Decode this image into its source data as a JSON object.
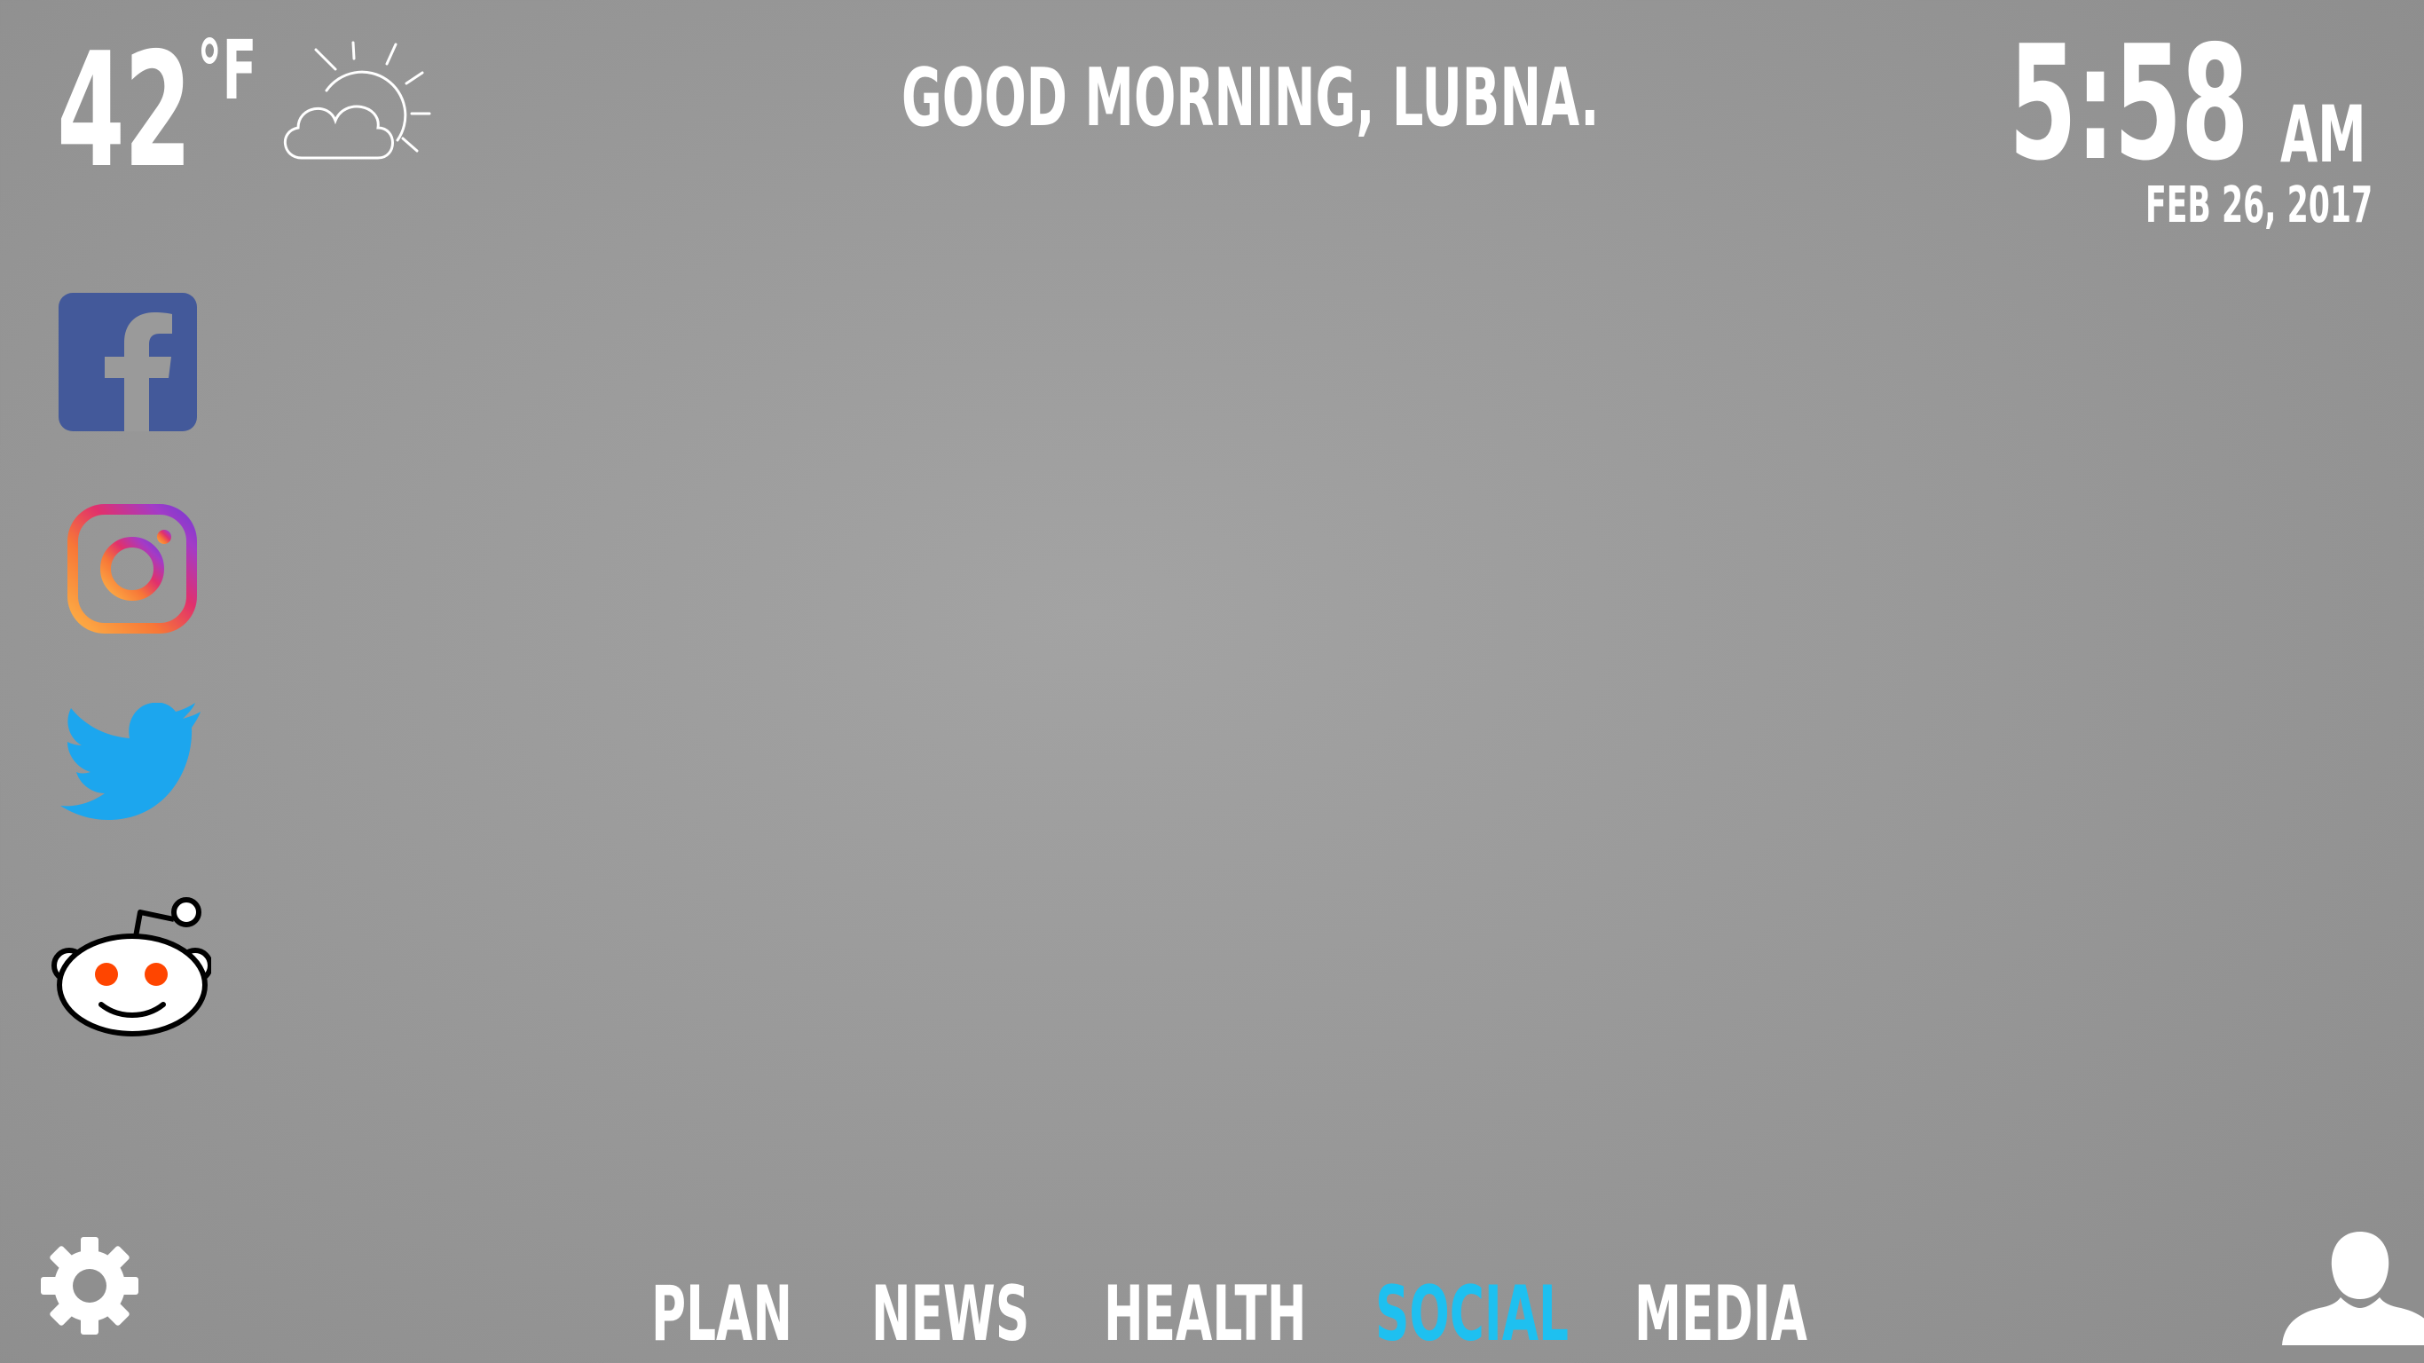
{
  "weather": {
    "temperature": "42",
    "unit": "°F",
    "condition_icon": "partly-cloudy-icon"
  },
  "greeting": "GOOD MORNING, LUBNA.",
  "clock": {
    "time": "5:58",
    "ampm": "AM",
    "date": "FEB 26, 2017"
  },
  "social_links": [
    {
      "name": "facebook",
      "icon": "facebook-icon",
      "color": "#3b5998"
    },
    {
      "name": "instagram",
      "icon": "instagram-icon",
      "color": "#e1306c"
    },
    {
      "name": "twitter",
      "icon": "twitter-icon",
      "color": "#1da1f2"
    },
    {
      "name": "reddit",
      "icon": "reddit-icon",
      "color": "#ff4500"
    }
  ],
  "nav": {
    "items": [
      {
        "label": "PLAN"
      },
      {
        "label": "NEWS"
      },
      {
        "label": "HEALTH"
      },
      {
        "label": "SOCIAL"
      },
      {
        "label": "MEDIA"
      }
    ],
    "active": "SOCIAL",
    "active_color": "#1ec0f0"
  },
  "footer": {
    "settings_icon": "gear-icon",
    "profile_icon": "user-icon"
  }
}
